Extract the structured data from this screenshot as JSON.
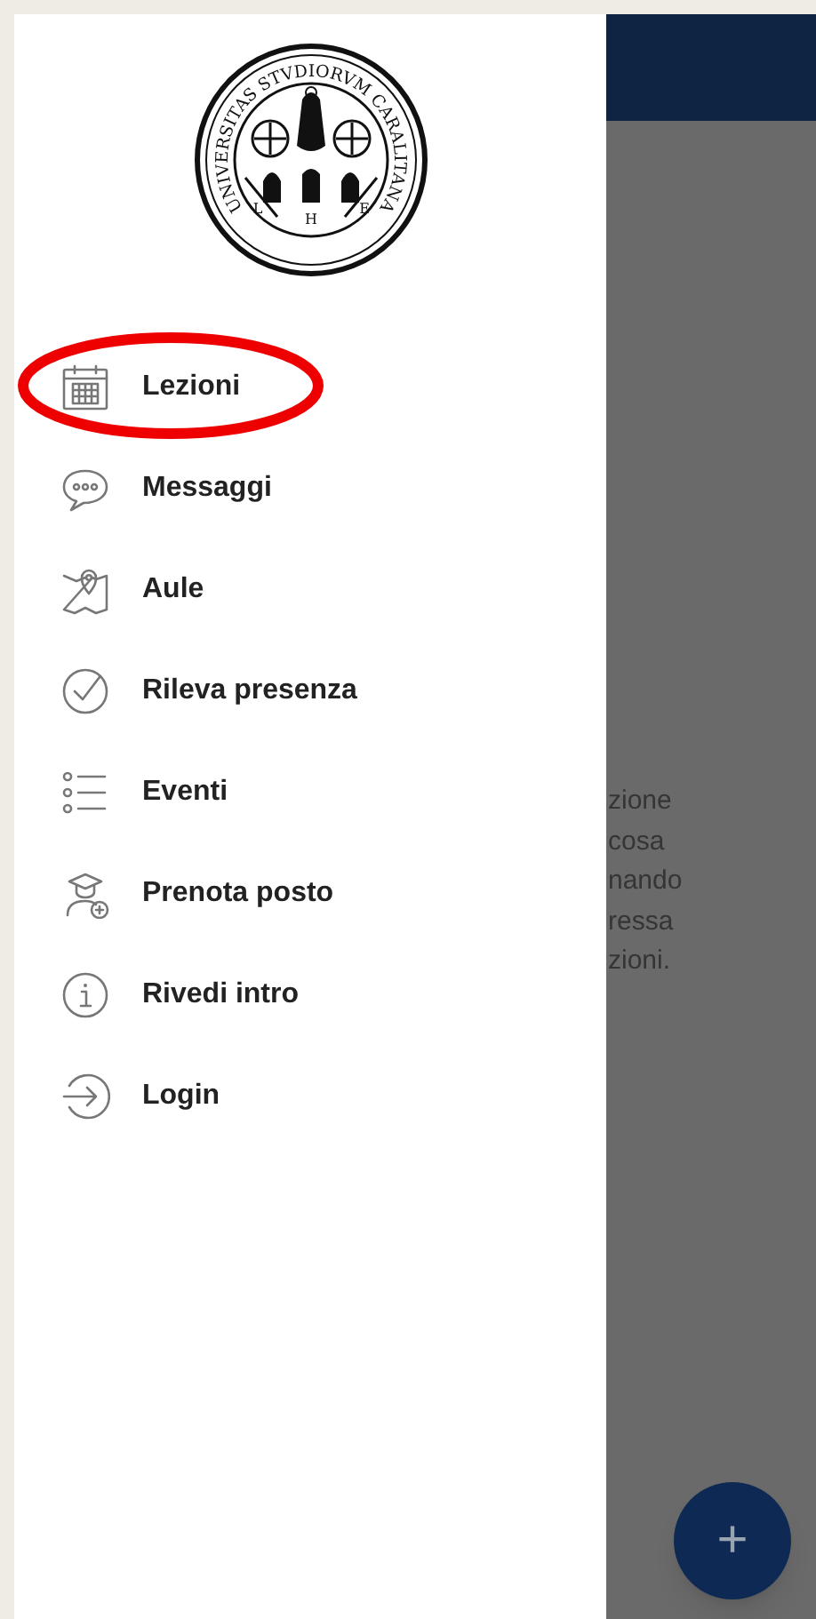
{
  "drawer": {
    "seal": {
      "ring_text": "UNIVERSITAS STVDIORVM CARALITANA",
      "letters": [
        "L",
        "H",
        "E"
      ]
    },
    "menu": [
      {
        "label": "Lezioni",
        "circled": true
      },
      {
        "label": "Messaggi",
        "circled": false
      },
      {
        "label": "Aule",
        "circled": false
      },
      {
        "label": "Rileva presenza",
        "circled": false
      },
      {
        "label": "Eventi",
        "circled": false
      },
      {
        "label": "Prenota posto",
        "circled": false
      },
      {
        "label": "Rivedi intro",
        "circled": false
      },
      {
        "label": "Login",
        "circled": false
      }
    ]
  },
  "annotation": {
    "color": "#ee0000"
  },
  "background": {
    "text_lines": [
      "zione",
      "cosa",
      "nando",
      "ressa",
      "zioni."
    ],
    "fab": "+"
  }
}
